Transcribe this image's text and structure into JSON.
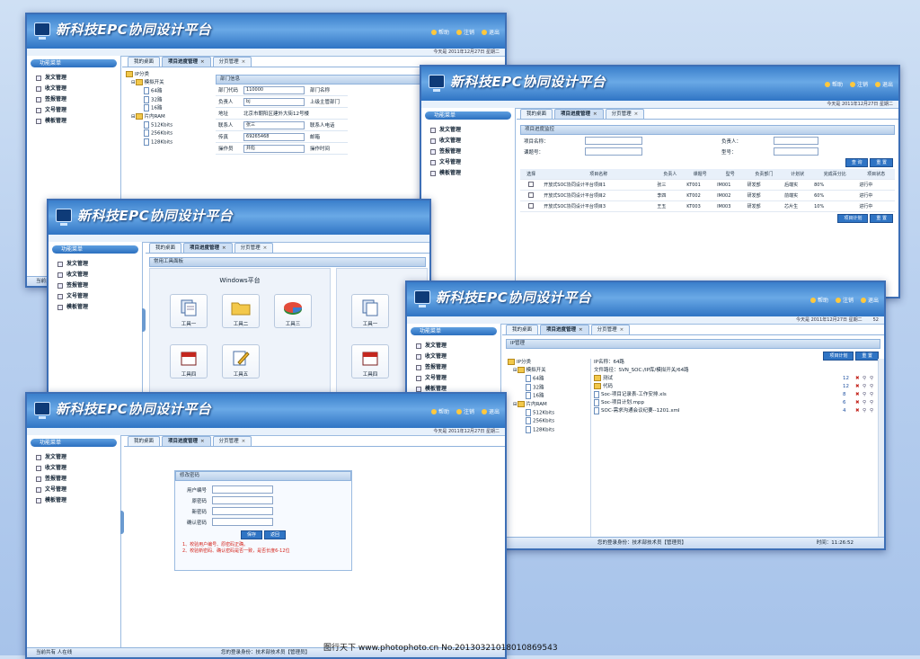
{
  "app": {
    "title": "新科技EPC协同设计平台",
    "links": [
      "帮助",
      "注销",
      "退出"
    ],
    "date": "今天是 2011年12月27日 星期二",
    "menu_title": "功能菜单",
    "menu": [
      "发文管理",
      "收文管理",
      "签报管理",
      "文号管理",
      "模板管理"
    ],
    "tabs": [
      "我的桌面",
      "项目进度管理",
      "分页管理"
    ]
  },
  "win_dept": {
    "tree": [
      "IP分类",
      "模拟开关",
      "64路",
      "32路",
      "16路",
      "片内RAM",
      "512Kbits",
      "256Kbits",
      "128Kbits"
    ],
    "panel_title": "部门信息",
    "rows": [
      {
        "l1": "部门代码",
        "v1": "110000",
        "l2": "部门名称",
        "v2": ""
      },
      {
        "l1": "负责人",
        "v1": "bj",
        "l2": "上级主管部门",
        "v2": ""
      },
      {
        "l1": "地址",
        "v1": "北京市朝阳区建外大街12号楼",
        "l2": "",
        "v2": ""
      },
      {
        "l1": "联系人",
        "v1": "张三",
        "l2": "联系人电话",
        "v2": ""
      },
      {
        "l1": "传真",
        "v1": "69265468",
        "l2": "邮箱",
        "v2": ""
      },
      {
        "l1": "操作员",
        "v1": "并彪",
        "l2": "操作时间",
        "v2": ""
      }
    ],
    "footer_left": "当前共有"
  },
  "win_proj": {
    "panel_title": "项目进度监控",
    "filters": {
      "name": "项目名称：",
      "owner": "负责人：",
      "code": "课题号：",
      "type": "型号："
    },
    "query": "查 询",
    "reset": "重 置",
    "headers": [
      "选择",
      "项目名称",
      "负责人",
      "课题号",
      "型号",
      "负责部门",
      "计划状",
      "完成百分比",
      "项目状态"
    ],
    "rows": [
      [
        "开放式SOC协同设计平台项目1",
        "张三",
        "KT001",
        "IM001",
        "研发部",
        "后端实",
        "80%",
        "进行中"
      ],
      [
        "开放式SOC协同设计平台项目2",
        "李四",
        "KT002",
        "IM002",
        "研发部",
        "前端实",
        "60%",
        "进行中"
      ],
      [
        "开放式SOC协同设计平台项目3",
        "王五",
        "KT003",
        "IM003",
        "研发部",
        "芯片生",
        "10%",
        "进行中"
      ]
    ],
    "plan_btn": "项目计划",
    "reset2": "重 置"
  },
  "win_tools": {
    "panel_title": "常用工具面板",
    "group_title": "Windows平台",
    "tools": [
      "工具一",
      "工具二",
      "工具三",
      "工具四",
      "工具五"
    ],
    "tools_right": [
      "工具一",
      "工具四"
    ]
  },
  "win_ip": {
    "panel_title": "IP管理",
    "plan_btn": "项目计划",
    "reset": "重 置",
    "ip_name": "IP名称：64路",
    "path": "文件路径：SVN_SOC:/IP库/模拟开关/64路",
    "files": [
      {
        "name": "测试",
        "count": "12"
      },
      {
        "name": "代码",
        "count": "12"
      },
      {
        "name": "Soc-项目记录表-工作安排.xls",
        "count": "8"
      },
      {
        "name": "Soc-项目计划.mpp",
        "count": "6"
      },
      {
        "name": "SOC-需求沟通会议纪要--1201.xml",
        "count": "4"
      }
    ],
    "footer_user": "您的登录身份：技术部技术员【管理员】",
    "footer_time": "时间：11:26:52",
    "corner": "52"
  },
  "win_pwd": {
    "panel_title": "修改密码",
    "labels": [
      "用户编号",
      "原密码",
      "新密码",
      "确认密码"
    ],
    "save": "保存",
    "back": "返回",
    "notes": [
      "1、校验用户编号、原密码正确。",
      "2、校验新密码、确认密码是否一致，是否长度6-12位"
    ],
    "footer_left": "当前共有 人在线",
    "footer_user": "您的登录身份：技术部技术员【管理员】"
  },
  "watermark": "图行天下 www.photophoto.cn No.20130321018010869543",
  "colors": {
    "header": "#3a7fcb",
    "accent": "#2f74c4",
    "delete": "#c4261e"
  }
}
